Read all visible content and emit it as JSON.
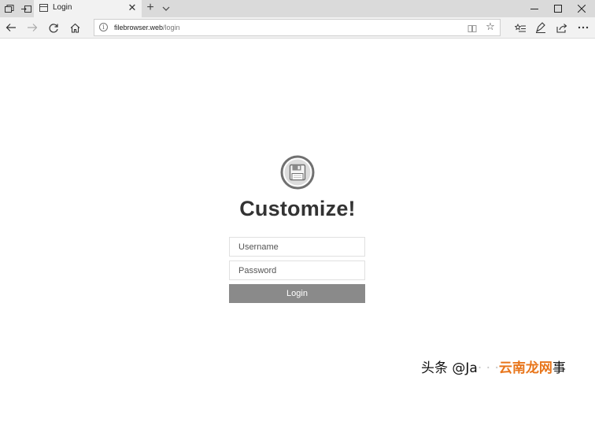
{
  "browser": {
    "tab": {
      "title": "Login"
    },
    "url": {
      "host": "filebrowser.web",
      "path": "/login"
    }
  },
  "page": {
    "title": "Customize!",
    "username_placeholder": "Username",
    "password_placeholder": "Password",
    "login_label": "Login"
  },
  "watermark": {
    "prefix": "头条 @Ja",
    "middle": "云南龙网",
    "suffix": "事"
  },
  "colors": {
    "login_button": "#8a8a8a",
    "tab_strip": "#dadada",
    "toolbar": "#f2f2f2",
    "watermark_accent": "#e8751a"
  },
  "icons": [
    "tab-preview-icon",
    "set-aside-tabs-icon",
    "page-icon",
    "close-icon",
    "new-tab-icon",
    "chevron-down-icon",
    "minimize-icon",
    "maximize-icon",
    "window-close-icon",
    "back-icon",
    "forward-icon",
    "refresh-icon",
    "home-icon",
    "info-icon",
    "reading-view-icon",
    "favorite-star-icon",
    "favorites-hub-icon",
    "pen-icon",
    "share-icon",
    "more-icon",
    "floppy-disk-logo"
  ]
}
